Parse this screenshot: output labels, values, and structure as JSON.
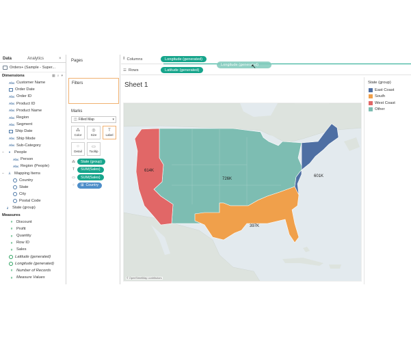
{
  "data_pane": {
    "tabs": [
      "Data",
      "Analytics"
    ],
    "close_glyph": "×",
    "source": "Orders+ (Sample - Super...",
    "dimensions_header": "Dimensions",
    "dimensions": [
      {
        "label": "Customer Name",
        "icon": "abc",
        "kind": "string"
      },
      {
        "label": "Order Date",
        "icon": "calendar",
        "kind": "date"
      },
      {
        "label": "Order ID",
        "icon": "abc",
        "kind": "string"
      },
      {
        "label": "Product ID",
        "icon": "abc",
        "kind": "string"
      },
      {
        "label": "Product Name",
        "icon": "abc",
        "kind": "string"
      },
      {
        "label": "Region",
        "icon": "abc",
        "kind": "string"
      },
      {
        "label": "Segment",
        "icon": "abc",
        "kind": "string"
      },
      {
        "label": "Ship Date",
        "icon": "calendar",
        "kind": "date"
      },
      {
        "label": "Ship Mode",
        "icon": "abc",
        "kind": "string"
      },
      {
        "label": "Sub-Category",
        "icon": "abc",
        "kind": "string"
      }
    ],
    "people_folder": "People",
    "people_fields": [
      {
        "label": "Person",
        "icon": "abc"
      },
      {
        "label": "Region (People)",
        "icon": "abc"
      }
    ],
    "mapping_folder": "Mapping Items",
    "mapping_fields": [
      {
        "label": "Country",
        "icon": "globe"
      },
      {
        "label": "State",
        "icon": "globe"
      },
      {
        "label": "City",
        "icon": "globe"
      },
      {
        "label": "Postal Code",
        "icon": "globe"
      }
    ],
    "state_group": "State (group)",
    "measures_header": "Measures",
    "measures": [
      {
        "label": "Discount",
        "icon": "#",
        "italic": false
      },
      {
        "label": "Profit",
        "icon": "#",
        "italic": false
      },
      {
        "label": "Quantity",
        "icon": "#",
        "italic": false
      },
      {
        "label": "Row ID",
        "icon": "#",
        "italic": false
      },
      {
        "label": "Sales",
        "icon": "#",
        "italic": false
      },
      {
        "label": "Latitude (generated)",
        "icon": "globe",
        "italic": true
      },
      {
        "label": "Longitude (generated)",
        "icon": "globe",
        "italic": true
      },
      {
        "label": "Number of Records",
        "icon": "#",
        "italic": true
      },
      {
        "label": "Measure Values",
        "icon": "#",
        "italic": true
      }
    ]
  },
  "cards": {
    "pages_title": "Pages",
    "filters_title": "Filters",
    "marks_title": "Marks",
    "mark_type": "Filled Map",
    "mark_buttons": [
      {
        "label": "Color",
        "glyph": "⁂"
      },
      {
        "label": "Size",
        "glyph": "◎"
      },
      {
        "label": "Label",
        "glyph": "T"
      },
      {
        "label": "Detail",
        "glyph": "⁘"
      },
      {
        "label": "Tooltip",
        "glyph": "▭"
      }
    ],
    "mark_pills": [
      {
        "label": "State (group)",
        "icon": "⁂",
        "color": "green"
      },
      {
        "label": "SUM(Sales)",
        "icon": "T",
        "color": "green"
      },
      {
        "label": "SUM(Sales)",
        "icon": "▭",
        "color": "green"
      },
      {
        "label": "Country",
        "icon": "⁘",
        "color": "blue",
        "prefix": "⊞"
      }
    ]
  },
  "shelves": {
    "columns_label": "Columns",
    "rows_label": "Rows",
    "columns_pill": "Longitude (generated)",
    "rows_pill": "Latitude (generated)",
    "drag_pill": "Longitude (generated)"
  },
  "view": {
    "sheet_title": "Sheet 1",
    "attribution": "© OpenStreetMap contributors",
    "region_labels": {
      "west_coast": "614K",
      "other": "726K",
      "east_coast": "601K",
      "south": "397K"
    }
  },
  "legend": {
    "title": "State (group)",
    "items": [
      {
        "label": "East Coast",
        "color": "#4e6fa3"
      },
      {
        "label": "South",
        "color": "#f0a04b"
      },
      {
        "label": "West Coast",
        "color": "#e16767"
      },
      {
        "label": "Other",
        "color": "#7dbdb2"
      }
    ]
  },
  "colors": {
    "pill_green": "#17a58c",
    "pill_blue": "#4e8ec9",
    "water": "#e3eaee",
    "land": "#dde3de"
  }
}
